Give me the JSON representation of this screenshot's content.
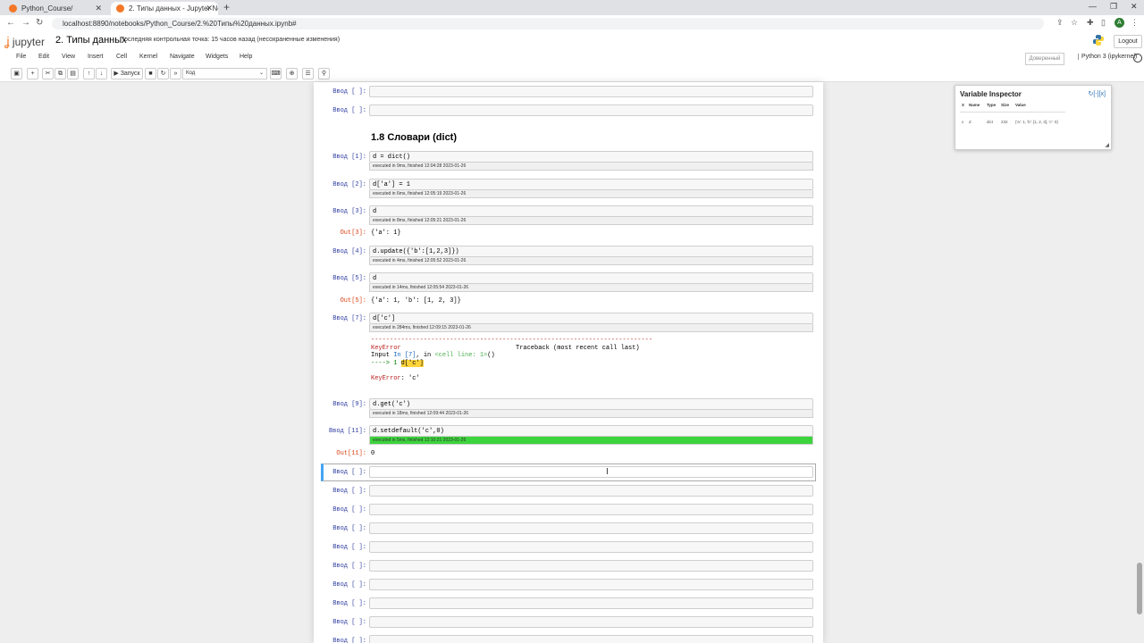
{
  "browser": {
    "tabs": [
      {
        "label": "Python_Course/"
      },
      {
        "label": "2. Типы данных - Jupyter Noteb"
      }
    ],
    "url": "localhost:8890/notebooks/Python_Course/2.%20Типы%20данных.ipynb#",
    "avatar_letter": "A"
  },
  "header": {
    "logo_text": "jupyter",
    "notebook_title": "2. Типы данных",
    "checkpoint": "Последняя контрольная точка: 15 часов назад  (несохраненные изменения)",
    "logout_label": "Logout"
  },
  "menu": {
    "items": [
      "File",
      "Edit",
      "View",
      "Insert",
      "Cell",
      "Kernel",
      "Navigate",
      "Widgets",
      "Help"
    ],
    "trusted": "Доверенный",
    "kernel": "Python 3 (ipykernel)"
  },
  "toolbar": {
    "run_label": "Запуск",
    "cell_type": "Код"
  },
  "notebook": {
    "section_heading": "1.8  Словари (dict)",
    "empty_prompt": "Ввод [ ]:",
    "cells": [
      {
        "prompt": "Ввод [1]:",
        "code": "d = dict()",
        "exec": "executed in 9ms, finished 12:04:28 2023-01-26"
      },
      {
        "prompt": "Ввод [2]:",
        "code": "d['a'] = 1",
        "exec": "executed in 6ms, finished 12:05:19 2023-01-26"
      },
      {
        "prompt": "Ввод [3]:",
        "code": "d",
        "exec": "executed in 8ms, finished 12:05:21 2023-01-26",
        "out_prompt": "Out[3]:",
        "out": "{'a': 1}"
      },
      {
        "prompt": "Ввод [4]:",
        "code": "d.update({'b':[1,2,3]})",
        "exec": "executed in 4ms, finished 12:05:52 2023-01-26"
      },
      {
        "prompt": "Ввод [5]:",
        "code": "d",
        "exec": "executed in 14ms, finished 12:05:54 2023-01-26",
        "out_prompt": "Out[5]:",
        "out": "{'a': 1, 'b': [1, 2, 3]}"
      },
      {
        "prompt": "Ввод [7]:",
        "code": "d['c']",
        "exec": "executed in 284ms, finished 12:09:15 2023-01-26"
      },
      {
        "prompt": "Ввод [9]:",
        "code": "d.get('c')",
        "exec": "executed in 18ms, finished 12:09:44 2023-01-26"
      },
      {
        "prompt": "Ввод [11]:",
        "code": "d.setdefault('c',0)",
        "exec": "executed in 5ms, finished 12:10:21 2023-01-26",
        "out_prompt": "Out[11]:",
        "out": "0"
      }
    ],
    "traceback": {
      "dashes": "---------------------------------------------------------------------------",
      "error_name": "KeyError",
      "traceback_title": "Traceback (most recent call last)",
      "input_line_pre": "Input ",
      "input_ref": "In [7]",
      "input_line_mid": ", in ",
      "cell_ref": "<cell line: 1>",
      "input_line_post": "()",
      "arrow_line": "----> 1 ",
      "arrow_code": "d['c']",
      "error_msg_name": "KeyError",
      "error_msg": ": 'c'"
    }
  },
  "variable_inspector": {
    "title": "Variable Inspector",
    "buttons": "↻[-][x]",
    "columns": [
      "X",
      "Name",
      "Type",
      "Size",
      "Value"
    ],
    "rows": [
      {
        "x": "x",
        "name": "d",
        "type": "dict",
        "size": "232",
        "value": "{'a': 1, 'b': [1, 2, 3], 'c': 0}"
      }
    ]
  }
}
